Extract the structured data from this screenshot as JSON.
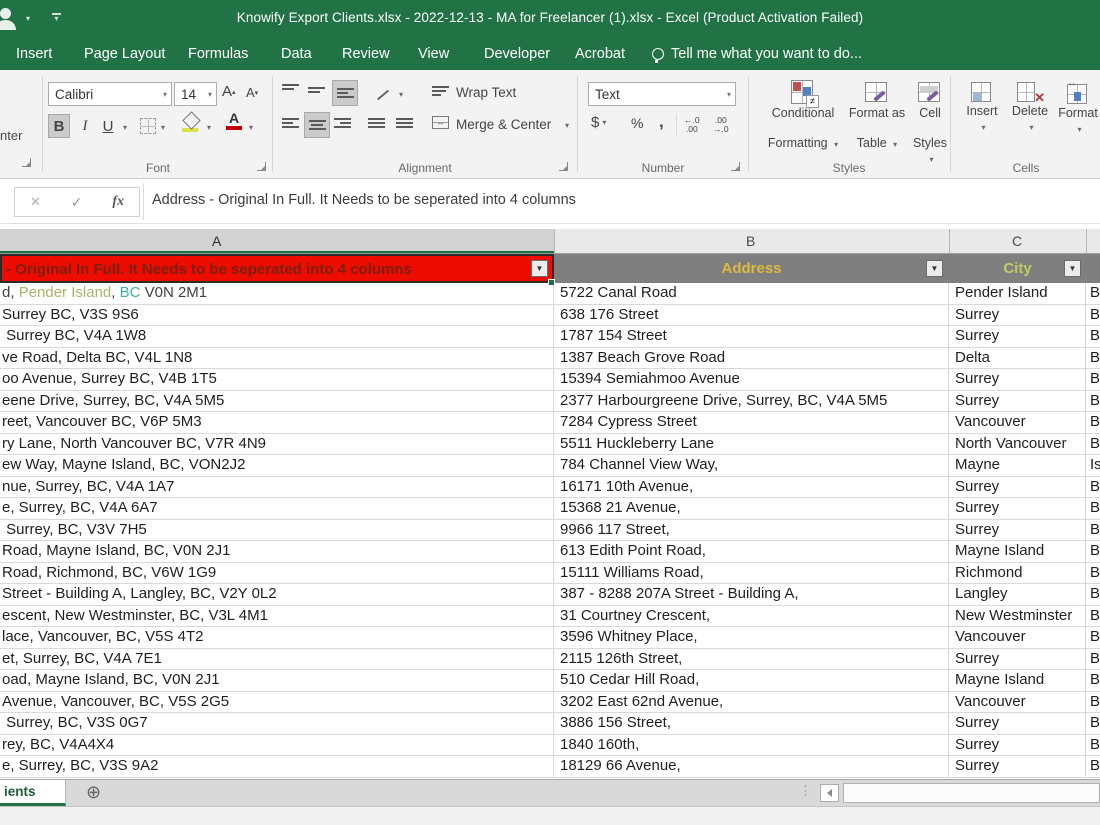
{
  "titlebar": {
    "title": "Knowify Export Clients.xlsx - 2022-12-13 - MA for Freelancer (1).xlsx - Excel (Product Activation Failed)"
  },
  "ribbon_tabs": [
    {
      "label": "Insert"
    },
    {
      "label": "Page Layout"
    },
    {
      "label": "Formulas"
    },
    {
      "label": "Data"
    },
    {
      "label": "Review"
    },
    {
      "label": "View"
    },
    {
      "label": "Developer"
    },
    {
      "label": "Acrobat"
    }
  ],
  "tellme": {
    "label": "Tell me what you want to do..."
  },
  "ribbon": {
    "clipboard": {
      "fragment_label": "nter"
    },
    "font": {
      "group_label": "Font",
      "font_name": "Calibri",
      "font_size": "14",
      "bold": "B",
      "italic": "I",
      "underline": "U",
      "grow_font": "A",
      "shrink_font": "A"
    },
    "alignment": {
      "group_label": "Alignment",
      "wrap_text": "Wrap Text",
      "merge_center": "Merge & Center"
    },
    "number": {
      "group_label": "Number",
      "format": "Text",
      "currency": "$",
      "percent": "%",
      "comma": ",",
      "inc_decimal": "←.0\n.00",
      "dec_decimal": ".00\n→.0"
    },
    "styles": {
      "group_label": "Styles",
      "conditional_formatting": [
        "Conditional",
        "Formatting"
      ],
      "format_as_table": [
        "Format as",
        "Table"
      ],
      "cell_styles": [
        "Cell",
        "Styles"
      ],
      "cf_badge": "≠"
    },
    "cells": {
      "group_label": "Cells",
      "insert": "Insert",
      "delete": "Delete",
      "format": "Format",
      "delete_glyph": "✕",
      "format_glyph": "↔"
    }
  },
  "formula_bar": {
    "cancel": "✕",
    "enter": "✓",
    "fx": "fx",
    "value": "Address - Original In Full. It Needs to be seperated into 4 columns"
  },
  "sheet": {
    "columns": [
      {
        "letter": "A"
      },
      {
        "letter": "B"
      },
      {
        "letter": "C"
      }
    ],
    "header_row": {
      "a_visible": "- Original In Full. It Needs to be seperated into 4 columns",
      "b": "Address",
      "c": "City",
      "filter_glyph": "▼"
    },
    "rows": [
      {
        "a_seg": [
          [
            "d, ",
            "#404040"
          ],
          [
            "Pender Island",
            "#a9b469"
          ],
          [
            ", ",
            "#404040"
          ],
          [
            "BC",
            "#3ab0a2"
          ],
          [
            " V0N 2M1",
            "#404040"
          ]
        ],
        "b": "5722 Canal Road",
        "c": "Pender Island",
        "d": "B"
      },
      {
        "a": "Surrey BC, V3S 9S6",
        "b": "638 176 Street",
        "c": "Surrey",
        "d": "B"
      },
      {
        "a": " Surrey BC, V4A 1W8",
        "b": "1787 154 Street",
        "c": "Surrey",
        "d": "B"
      },
      {
        "a": "ve Road, Delta BC, V4L 1N8",
        "b": "1387 Beach Grove Road",
        "c": "Delta",
        "d": "B"
      },
      {
        "a": "oo Avenue, Surrey BC, V4B 1T5",
        "b": "15394 Semiahmoo Avenue",
        "c": "Surrey",
        "d": "B"
      },
      {
        "a": "eene Drive, Surrey, BC, V4A 5M5",
        "b": "2377 Harbourgreene Drive, Surrey, BC, V4A 5M5",
        "c": "Surrey",
        "d": "B"
      },
      {
        "a": "reet, Vancouver BC, V6P 5M3",
        "b": "7284 Cypress Street",
        "c": "Vancouver",
        "d": "B"
      },
      {
        "a": "ry Lane, North Vancouver BC, V7R 4N9",
        "b": "5511 Huckleberry Lane",
        "c": "North Vancouver",
        "d": "B"
      },
      {
        "a": "ew Way, Mayne Island, BC, VON2J2",
        "b": "784 Channel View Way,",
        "c": "Mayne",
        "d": "Is"
      },
      {
        "a": "nue, Surrey, BC, V4A 1A7",
        "b": "16171 10th Avenue,",
        "c": "Surrey",
        "d": "B"
      },
      {
        "a": "e, Surrey, BC, V4A 6A7",
        "b": "15368 21 Avenue,",
        "c": "Surrey",
        "d": "B"
      },
      {
        "a": " Surrey, BC, V3V 7H5",
        "b": "9966 117 Street,",
        "c": "Surrey",
        "d": "B"
      },
      {
        "a": "Road, Mayne Island, BC, V0N 2J1",
        "b": "613 Edith Point Road,",
        "c": "Mayne Island",
        "d": "B"
      },
      {
        "a": "Road, Richmond, BC, V6W 1G9",
        "b": "15111 Williams Road,",
        "c": "Richmond",
        "d": "B"
      },
      {
        "a": "Street - Building A, Langley, BC, V2Y 0L2",
        "b": "387 - 8288 207A Street - Building A,",
        "c": "Langley",
        "d": "B"
      },
      {
        "a": "escent, New Westminster, BC, V3L 4M1",
        "b": "31 Courtney Crescent,",
        "c": "New Westminster",
        "d": "B"
      },
      {
        "a": "lace, Vancouver, BC, V5S 4T2",
        "b": "3596 Whitney Place,",
        "c": "Vancouver",
        "d": "B"
      },
      {
        "a": "et, Surrey, BC, V4A 7E1",
        "b": "2115 126th Street,",
        "c": "Surrey",
        "d": "B"
      },
      {
        "a": "oad, Mayne Island, BC, V0N 2J1",
        "b": "510 Cedar Hill Road,",
        "c": "Mayne Island",
        "d": "B"
      },
      {
        "a": "Avenue, Vancouver, BC, V5S 2G5",
        "b": "3202 East 62nd Avenue,",
        "c": "Vancouver",
        "d": "B"
      },
      {
        "a": " Surrey, BC, V3S 0G7",
        "b": "3886 156 Street,",
        "c": "Surrey",
        "d": "B"
      },
      {
        "a": "rey, BC, V4A4X4",
        "b": "1840 160th,",
        "c": "Surrey",
        "d": "B"
      },
      {
        "a": "e, Surrey, BC, V3S 9A2",
        "b": "18129 66 Avenue,",
        "c": "Surrey",
        "d": "B"
      }
    ]
  },
  "bottom": {
    "active_sheet_tab": "ients",
    "add_sheet_glyph": "⊕",
    "dots_glyph": "⋮"
  },
  "colors": {
    "excel_green": "#217346",
    "header_red": "#ee0b00",
    "header_red_text": "#7b2010",
    "header_gray": "#7f7f7f",
    "address_gold": "#dfb93f",
    "city_green": "#c2cb63",
    "highlight_olive": "#a9b469",
    "highlight_teal": "#3ab0a2",
    "fill_yellow": "#d8e04a",
    "font_color_red": "#c00000"
  }
}
